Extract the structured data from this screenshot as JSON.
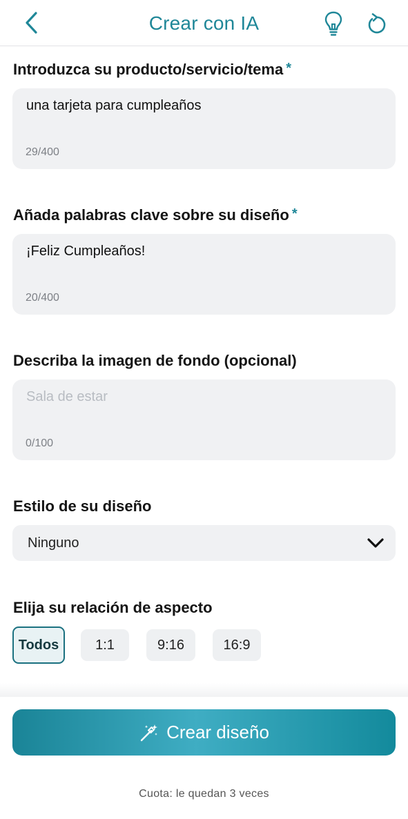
{
  "header": {
    "title": "Crear con IA",
    "back_icon": "chevron-left-icon",
    "hint_icon": "lightbulb-icon",
    "reset_icon": "refresh-icon",
    "accent_color": "#1f8798"
  },
  "product_field": {
    "label": "Introduzca su producto/servicio/tema",
    "required_mark": "*",
    "value": "una tarjeta para cumpleaños",
    "counter": "29/400"
  },
  "keywords_field": {
    "label": "Añada palabras clave sobre su diseño",
    "required_mark": "*",
    "value": "¡Feliz Cumpleaños!",
    "counter": "20/400"
  },
  "background_field": {
    "label": "Describa la imagen de fondo (opcional)",
    "placeholder": "Sala de estar",
    "value": "",
    "counter": "0/100"
  },
  "style_select": {
    "label": "Estilo de su diseño",
    "selected": "Ninguno",
    "icon": "chevron-down-icon"
  },
  "aspect_ratio": {
    "label": "Elija su relación de aspecto",
    "options": [
      "Todos",
      "1:1",
      "9:16",
      "16:9"
    ],
    "selected": "Todos"
  },
  "create_button": {
    "label": "Crear diseño",
    "icon": "magic-wand-icon"
  },
  "quota_text": "Cuota: le quedan 3 veces"
}
